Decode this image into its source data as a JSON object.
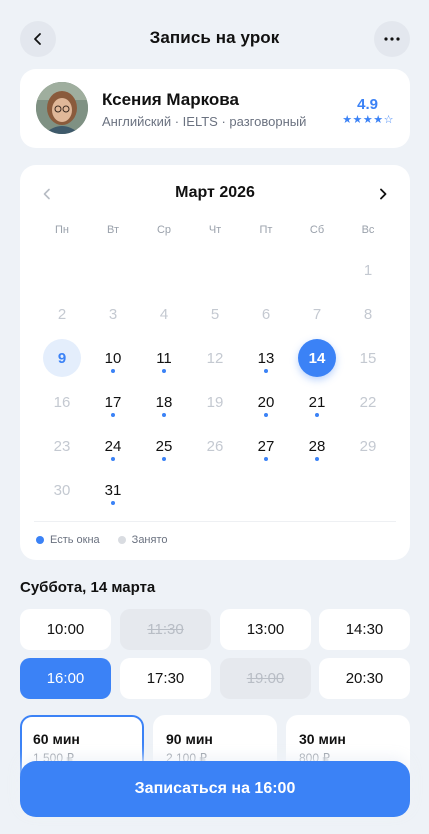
{
  "header": {
    "title": "Запись на урок",
    "back_icon": "chevron-left-icon",
    "more_icon": "more-horizontal-icon"
  },
  "tutor": {
    "name": "Ксения Маркова",
    "subjects": "Английский · IELTS · разговорный",
    "rating": "4.9",
    "stars": "★★★★☆",
    "accent": "#3b82f6"
  },
  "calendar": {
    "month": "Март 2026",
    "weekdays": [
      "Пн",
      "Вт",
      "Ср",
      "Чт",
      "Пт",
      "Сб",
      "Вс"
    ],
    "days": [
      {
        "n": "1",
        "state": "inactive"
      },
      {
        "n": "2",
        "state": "inactive"
      },
      {
        "n": "3",
        "state": "inactive"
      },
      {
        "n": "4",
        "state": "inactive"
      },
      {
        "n": "5",
        "state": "inactive"
      },
      {
        "n": "6",
        "state": "inactive"
      },
      {
        "n": "7",
        "state": "inactive"
      },
      {
        "n": "8",
        "state": "inactive"
      },
      {
        "n": "9",
        "state": "today"
      },
      {
        "n": "10",
        "state": "available"
      },
      {
        "n": "11",
        "state": "available"
      },
      {
        "n": "12",
        "state": "inactive"
      },
      {
        "n": "13",
        "state": "available"
      },
      {
        "n": "14",
        "state": "selected"
      },
      {
        "n": "15",
        "state": "inactive"
      },
      {
        "n": "16",
        "state": "inactive"
      },
      {
        "n": "17",
        "state": "available"
      },
      {
        "n": "18",
        "state": "available"
      },
      {
        "n": "19",
        "state": "inactive"
      },
      {
        "n": "20",
        "state": "available"
      },
      {
        "n": "21",
        "state": "available"
      },
      {
        "n": "22",
        "state": "inactive"
      },
      {
        "n": "23",
        "state": "inactive"
      },
      {
        "n": "24",
        "state": "available"
      },
      {
        "n": "25",
        "state": "available"
      },
      {
        "n": "26",
        "state": "inactive"
      },
      {
        "n": "27",
        "state": "available"
      },
      {
        "n": "28",
        "state": "available"
      },
      {
        "n": "29",
        "state": "inactive"
      },
      {
        "n": "30",
        "state": "inactive"
      },
      {
        "n": "31",
        "state": "available"
      }
    ],
    "first_weekday_index": 6,
    "legend": {
      "available": "Есть окна",
      "busy": "Занято",
      "available_color": "#3b82f6",
      "busy_color": "#d9dce1"
    }
  },
  "schedule": {
    "date_heading": "Суббота, 14 марта",
    "slots": [
      {
        "time": "10:00",
        "state": "free"
      },
      {
        "time": "11:30",
        "state": "disabled"
      },
      {
        "time": "13:00",
        "state": "free"
      },
      {
        "time": "14:30",
        "state": "free"
      },
      {
        "time": "16:00",
        "state": "selected"
      },
      {
        "time": "17:30",
        "state": "free"
      },
      {
        "time": "19:00",
        "state": "disabled"
      },
      {
        "time": "20:30",
        "state": "free"
      }
    ]
  },
  "durations": [
    {
      "title": "60 мин",
      "price": "1 500 ₽",
      "selected": true
    },
    {
      "title": "90 мин",
      "price": "2 100 ₽",
      "selected": false
    },
    {
      "title": "30 мин",
      "price": "800 ₽",
      "selected": false
    }
  ],
  "cta": {
    "label": "Записаться на 16:00"
  }
}
